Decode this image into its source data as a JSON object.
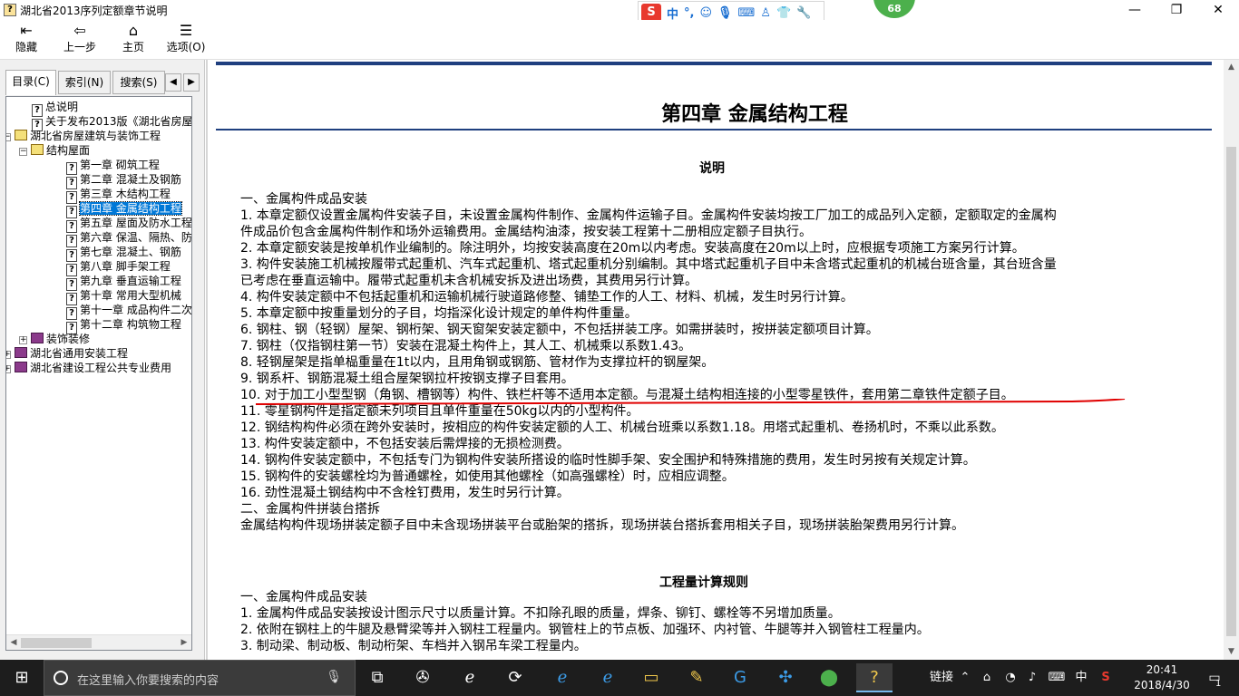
{
  "window": {
    "title": "湖北省2013序列定额章节说明",
    "minimize": "—",
    "restore": "❐",
    "close": "✕"
  },
  "ime": {
    "logo": "S",
    "items": [
      "中",
      "°,",
      "☺",
      "🎙",
      "⌨",
      "♙",
      "👕",
      "🔧"
    ]
  },
  "badge": "68",
  "toolbar": {
    "items": [
      {
        "icon": "hide-icon",
        "glyph": "⇤",
        "label": "隐藏"
      },
      {
        "icon": "back-icon",
        "glyph": "⇦",
        "label": "上一步"
      },
      {
        "icon": "home-icon",
        "glyph": "⌂",
        "label": "主页"
      },
      {
        "icon": "options-icon",
        "glyph": "☰",
        "label": "选项(O)"
      }
    ]
  },
  "nav": {
    "tabs": [
      "目录(C)",
      "索引(N)",
      "搜索(S)"
    ],
    "tab_prev": "◀",
    "tab_next": "▶",
    "tree": [
      {
        "level": 1,
        "type": "doc",
        "label": "总说明"
      },
      {
        "level": 1,
        "type": "doc",
        "label": "关于发布2013版《湖北省房屋"
      },
      {
        "level": 0,
        "type": "book-open",
        "exp": "−",
        "label": "湖北省房屋建筑与装饰工程"
      },
      {
        "level": 1,
        "type": "book-open",
        "exp": "−",
        "label": "结构屋面"
      },
      {
        "level": 2,
        "type": "doc",
        "label": "第一章  砌筑工程"
      },
      {
        "level": 2,
        "type": "doc",
        "label": "第二章  混凝土及钢筋"
      },
      {
        "level": 2,
        "type": "doc",
        "label": "第三章  木结构工程"
      },
      {
        "level": 2,
        "type": "doc",
        "label": "第四章  金属结构工程",
        "selected": true
      },
      {
        "level": 2,
        "type": "doc",
        "label": "第五章  屋面及防水工程"
      },
      {
        "level": 2,
        "type": "doc",
        "label": "第六章  保温、隔热、防"
      },
      {
        "level": 2,
        "type": "doc",
        "label": "第七章  混凝土、钢筋"
      },
      {
        "level": 2,
        "type": "doc",
        "label": "第八章  脚手架工程"
      },
      {
        "level": 2,
        "type": "doc",
        "label": "第九章  垂直运输工程"
      },
      {
        "level": 2,
        "type": "doc",
        "label": "第十章  常用大型机械"
      },
      {
        "level": 2,
        "type": "doc",
        "label": "第十一章  成品构件二次"
      },
      {
        "level": 2,
        "type": "doc",
        "label": "第十二章  构筑物工程"
      },
      {
        "level": 1,
        "type": "book",
        "exp": "+",
        "label": "装饰装修"
      },
      {
        "level": 0,
        "type": "book",
        "exp": "+",
        "label": "湖北省通用安装工程"
      },
      {
        "level": 0,
        "type": "book",
        "exp": "+",
        "label": "湖北省建设工程公共专业费用"
      }
    ]
  },
  "doc": {
    "chapter_title": "第四章  金属结构工程",
    "explain_title": "说明",
    "explain_lines": [
      "一、金属构件成品安装",
      "1. 本章定额仅设置金属构件安装子目，未设置金属构件制作、金属构件运输子目。金属构件安装均按工厂加工的成品列入定额，定额取定的金属构",
      "件成品价包含金属构件制作和场外运输费用。金属结构油漆，按安装工程第十二册相应定额子目执行。",
      "2. 本章定额安装是按单机作业编制的。除注明外，均按安装高度在20m以内考虑。安装高度在20m以上时，应根据专项施工方案另行计算。",
      "3. 构件安装施工机械按履带式起重机、汽车式起重机、塔式起重机分别编制。其中塔式起重机子目中未含塔式起重机的机械台班含量，其台班含量",
      "已考虑在垂直运输中。履带式起重机未含机械安拆及进出场费，其费用另行计算。",
      "4. 构件安装定额中不包括起重机和运输机械行驶道路修整、铺垫工作的人工、材料、机械，发生时另行计算。",
      "5. 本章定额中按重量划分的子目，均指深化设计规定的单件构件重量。",
      "6. 钢柱、钢（轻钢）屋架、钢桁架、钢天窗架安装定额中，不包括拼装工序。如需拼装时，按拼装定额项目计算。",
      "7. 钢柱（仅指钢柱第一节）安装在混凝土构件上，其人工、机械乘以系数1.43。",
      "8. 轻钢屋架是指单榀重量在1t以内，且用角钢或钢筋、管材作为支撑拉杆的钢屋架。",
      "9. 钢系杆、钢筋混凝土组合屋架钢拉杆按钢支撑子目套用。",
      "10. 对于加工小型型钢（角钢、槽钢等）构件、铁栏杆等不适用本定额。与混凝土结构相连接的小型零星铁件，套用第二章铁件定额子目。",
      "11. 零星钢构件是指定额未列项目且单件重量在50kg以内的小型构件。",
      "12. 钢结构构件必须在跨外安装时，按相应的构件安装定额的人工、机械台班乘以系数1.18。用塔式起重机、卷扬机时，不乘以此系数。",
      "13. 构件安装定额中，不包括安装后需焊接的无损检测费。",
      "14. 钢构件安装定额中，不包括专门为钢构件安装所搭设的临时性脚手架、安全围护和特殊措施的费用，发生时另按有关规定计算。",
      "15. 钢构件的安装螺栓均为普通螺栓，如使用其他螺栓（如高强螺栓）时，应相应调整。",
      "16. 劲性混凝土钢结构中不含栓钉费用，发生时另行计算。",
      "二、金属构件拼装台搭拆",
      "金属结构构件现场拼装定额子目中未含现场拼装平台或胎架的搭拆，现场拼装台搭拆套用相关子目，现场拼装胎架费用另行计算。"
    ],
    "rules_title": "工程量计算规则",
    "rules_lines": [
      "一、金属构件成品安装",
      "1. 金属构件成品安装按设计图示尺寸以质量计算。不扣除孔眼的质量，焊条、铆钉、螺栓等不另增加质量。",
      "2. 依附在钢柱上的牛腿及悬臂梁等并入钢柱工程量内。钢管柱上的节点板、加强环、内衬管、牛腿等并入钢管柱工程量内。",
      "3. 制动梁、制动板、制动桁架、车档并入钢吊车梁工程量内。"
    ],
    "annotation_color": "#e00000"
  },
  "taskbar": {
    "search_placeholder": "在这里输入你要搜索的内容",
    "tray_link": "链接",
    "ime_lang": "中",
    "time": "20:41",
    "date": "2018/4/30",
    "notifications": "1"
  }
}
